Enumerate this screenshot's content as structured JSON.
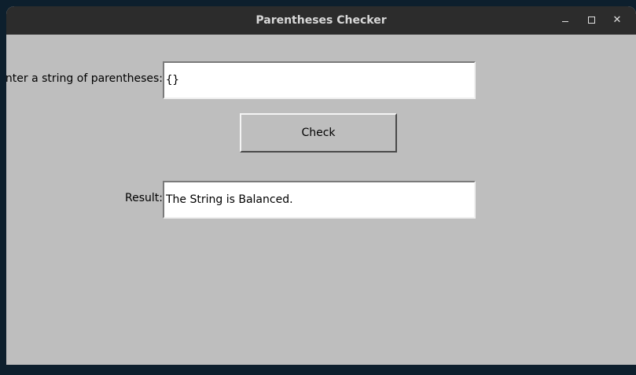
{
  "window": {
    "title": "Parentheses Checker",
    "controls": {
      "minimize_icon": "minimize-icon",
      "maximize_icon": "maximize-icon",
      "close_icon": "close-icon",
      "close_glyph": "✕"
    }
  },
  "form": {
    "input_label": "nter a string of parentheses:",
    "input_value": "{}",
    "check_button_label": "Check",
    "result_label": "Result:",
    "result_value": "The String is Balanced."
  },
  "colors": {
    "window_bg": "#bebebe",
    "titlebar_bg": "#2c2c2c",
    "desktop_bg": "#0d1f2d"
  }
}
